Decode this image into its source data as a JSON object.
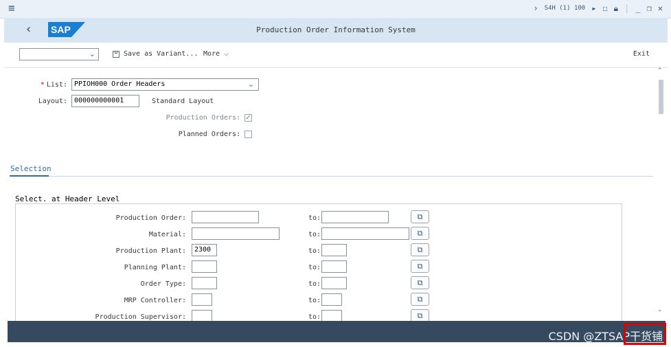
{
  "system_bar": {
    "system_info": "S4H (1) 100",
    "icons": [
      "menu-icon",
      "chevron-right-icon",
      "play-icon",
      "chat-icon",
      "lock-icon",
      "minimize-icon",
      "restore-icon",
      "close-icon"
    ]
  },
  "title_bar": {
    "back_glyph": "‹",
    "logo_text": "SAP",
    "title": "Production Order Information System"
  },
  "toolbar": {
    "variant_value": "",
    "save_variant_label": "Save as Variant...",
    "more_label": "More",
    "exit_label": "Exit"
  },
  "header": {
    "list_label": "List:",
    "list_value": "PPIOH000 Order Headers",
    "layout_label": "Layout:",
    "layout_value": "000000000001",
    "layout_desc": "Standard Layout",
    "production_orders_label": "Production Orders:",
    "production_orders_checked": true,
    "planned_orders_label": "Planned Orders:",
    "planned_orders_checked": false
  },
  "selection": {
    "tab_label": "Selection",
    "group_title": "Select. at Header Level",
    "to_label": "to:",
    "rows": [
      {
        "label": "Production Order:",
        "from": "",
        "to": ""
      },
      {
        "label": "Material:",
        "from": "",
        "to": ""
      },
      {
        "label": "Production Plant:",
        "from": "2300",
        "to": ""
      },
      {
        "label": "Planning Plant:",
        "from": "",
        "to": ""
      },
      {
        "label": "Order Type:",
        "from": "",
        "to": ""
      },
      {
        "label": "MRP Controller:",
        "from": "",
        "to": ""
      },
      {
        "label": "Production Supervisor:",
        "from": "",
        "to": ""
      }
    ]
  },
  "footer": {
    "watermark": "CSDN @ZTSAP干货铺"
  }
}
